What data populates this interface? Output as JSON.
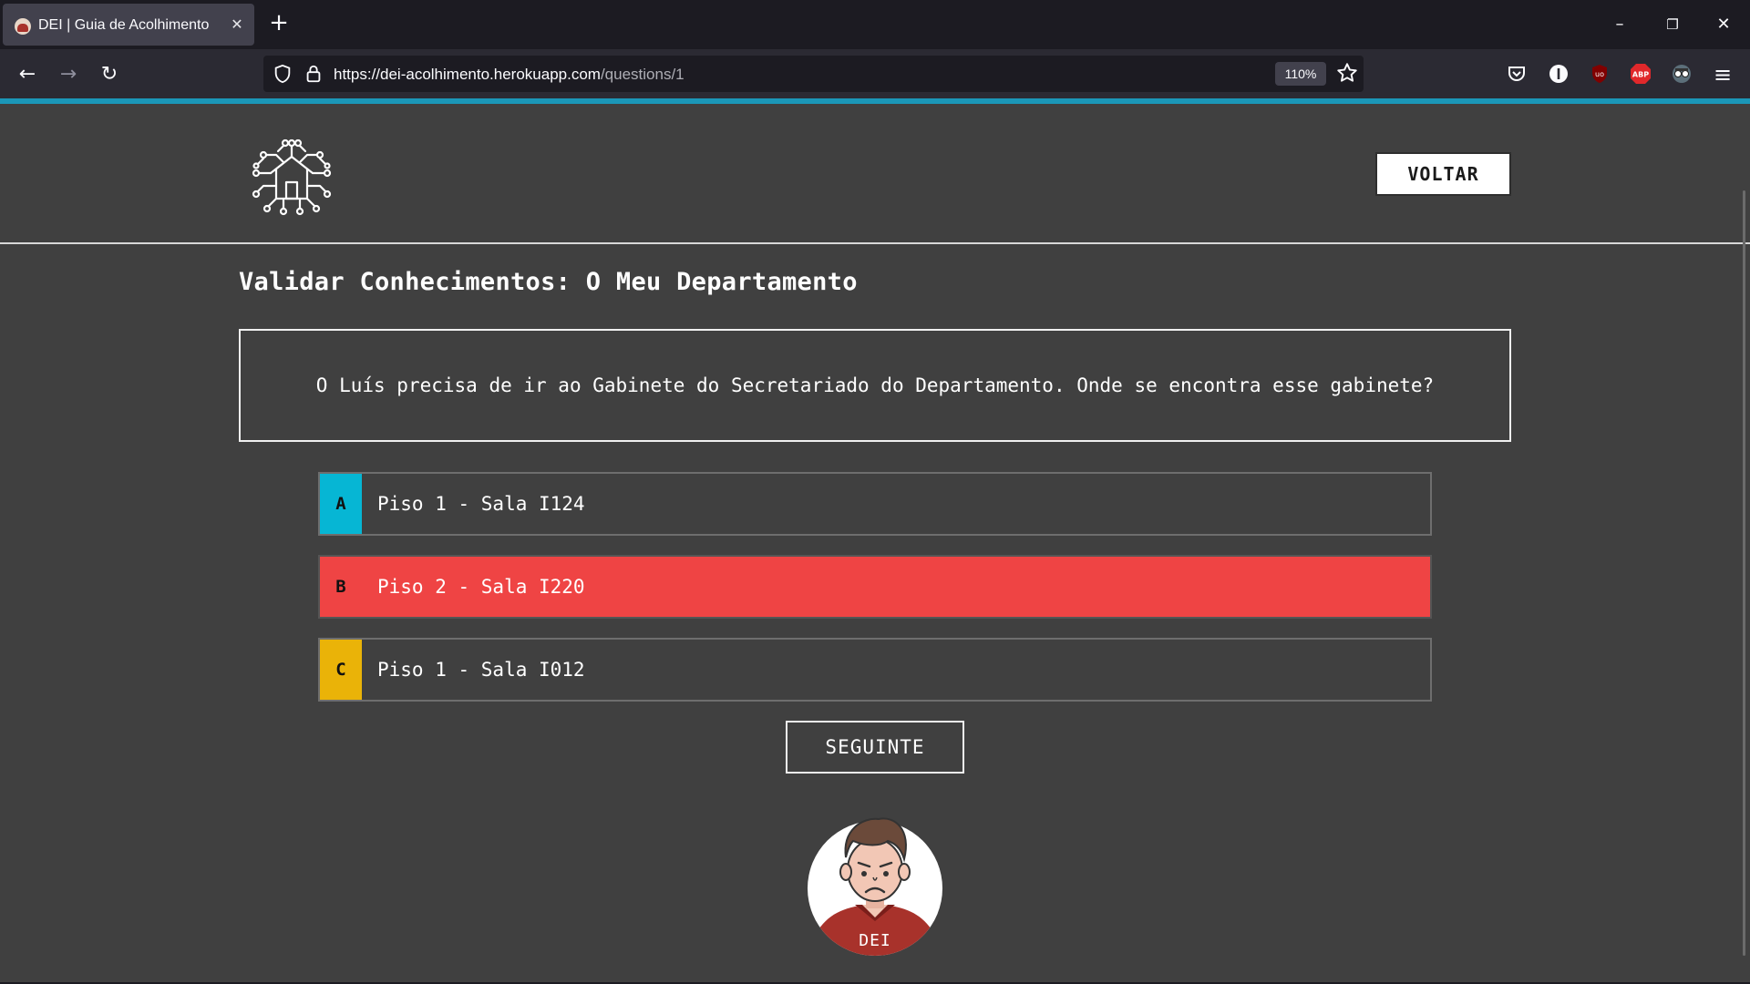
{
  "browser": {
    "tab_title": "DEI | Guia de Acolhimento",
    "tab_close": "✕",
    "new_tab": "+",
    "url_host": "https://dei-acolhimento.herokuapp.com",
    "url_path": "/questions/1",
    "zoom": "110%",
    "window_controls": {
      "minimize": "–",
      "restore": "❐",
      "close": "✕"
    },
    "nav": {
      "back": "←",
      "forward": "→",
      "reload": "↻",
      "menu": "≡"
    },
    "extension_icons": [
      "pocket-icon",
      "info-icon",
      "ublock-icon",
      "adblock-plus-icon",
      "glasses-extension-icon"
    ],
    "accent_color": "#1b97b8"
  },
  "header": {
    "back_button_label": "VOLTAR"
  },
  "main": {
    "title": "Validar Conhecimentos: O Meu Departamento",
    "question": "O Luís precisa de ir ao Gabinete do Secretariado do Departamento. Onde se encontra esse gabinete?",
    "answers": [
      {
        "letter": "A",
        "text": "Piso 1 - Sala I124",
        "color": "#06b6d4",
        "selected": false
      },
      {
        "letter": "B",
        "text": "Piso 2 - Sala I220",
        "color": "#ef4444",
        "selected": true
      },
      {
        "letter": "C",
        "text": "Piso 1 - Sala I012",
        "color": "#eab308",
        "selected": false
      }
    ],
    "next_button_label": "SEGUINTE",
    "mascot_label": "DEI"
  }
}
